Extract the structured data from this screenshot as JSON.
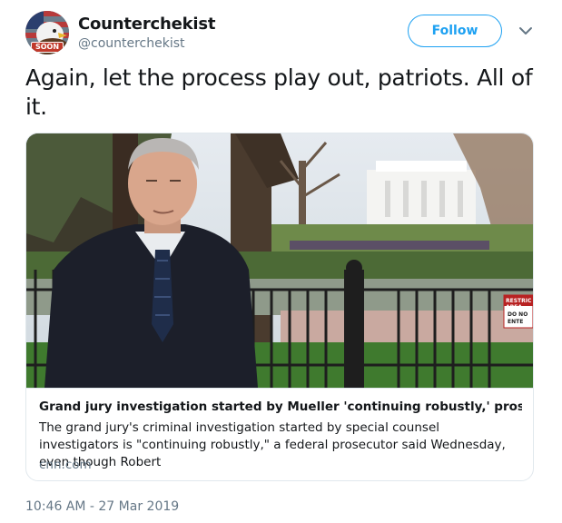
{
  "author": {
    "display_name": "Counterchekist",
    "handle": "@counterchekist",
    "avatar_badge": "SOON",
    "avatar_icon": "eagle-flag-avatar"
  },
  "follow": {
    "label": "Follow",
    "color": "#1da1f2"
  },
  "menu": {
    "icon": "chevron-down-icon"
  },
  "tweet": {
    "text": "Again, let the process play out, patriots. All of it."
  },
  "card": {
    "image_icon": "photo-man-in-suit-white-house",
    "title": "Grand jury investigation started by Mueller 'continuing robustly,' prosecutor...",
    "description": "The grand jury's criminal investigation started by special counsel investigators is \"continuing robustly,\" a federal prosecutor said Wednesday, even though Robert",
    "domain": "cnn.com",
    "sign_lines": [
      "RESTRIC",
      "AREA",
      "DO NO",
      "ENTE"
    ]
  },
  "meta": {
    "timestamp": "10:46 AM - 27 Mar 2019"
  },
  "colors": {
    "text": "#14171a",
    "secondary": "#657786",
    "border": "#e1e8ed",
    "accent": "#1da1f2"
  }
}
